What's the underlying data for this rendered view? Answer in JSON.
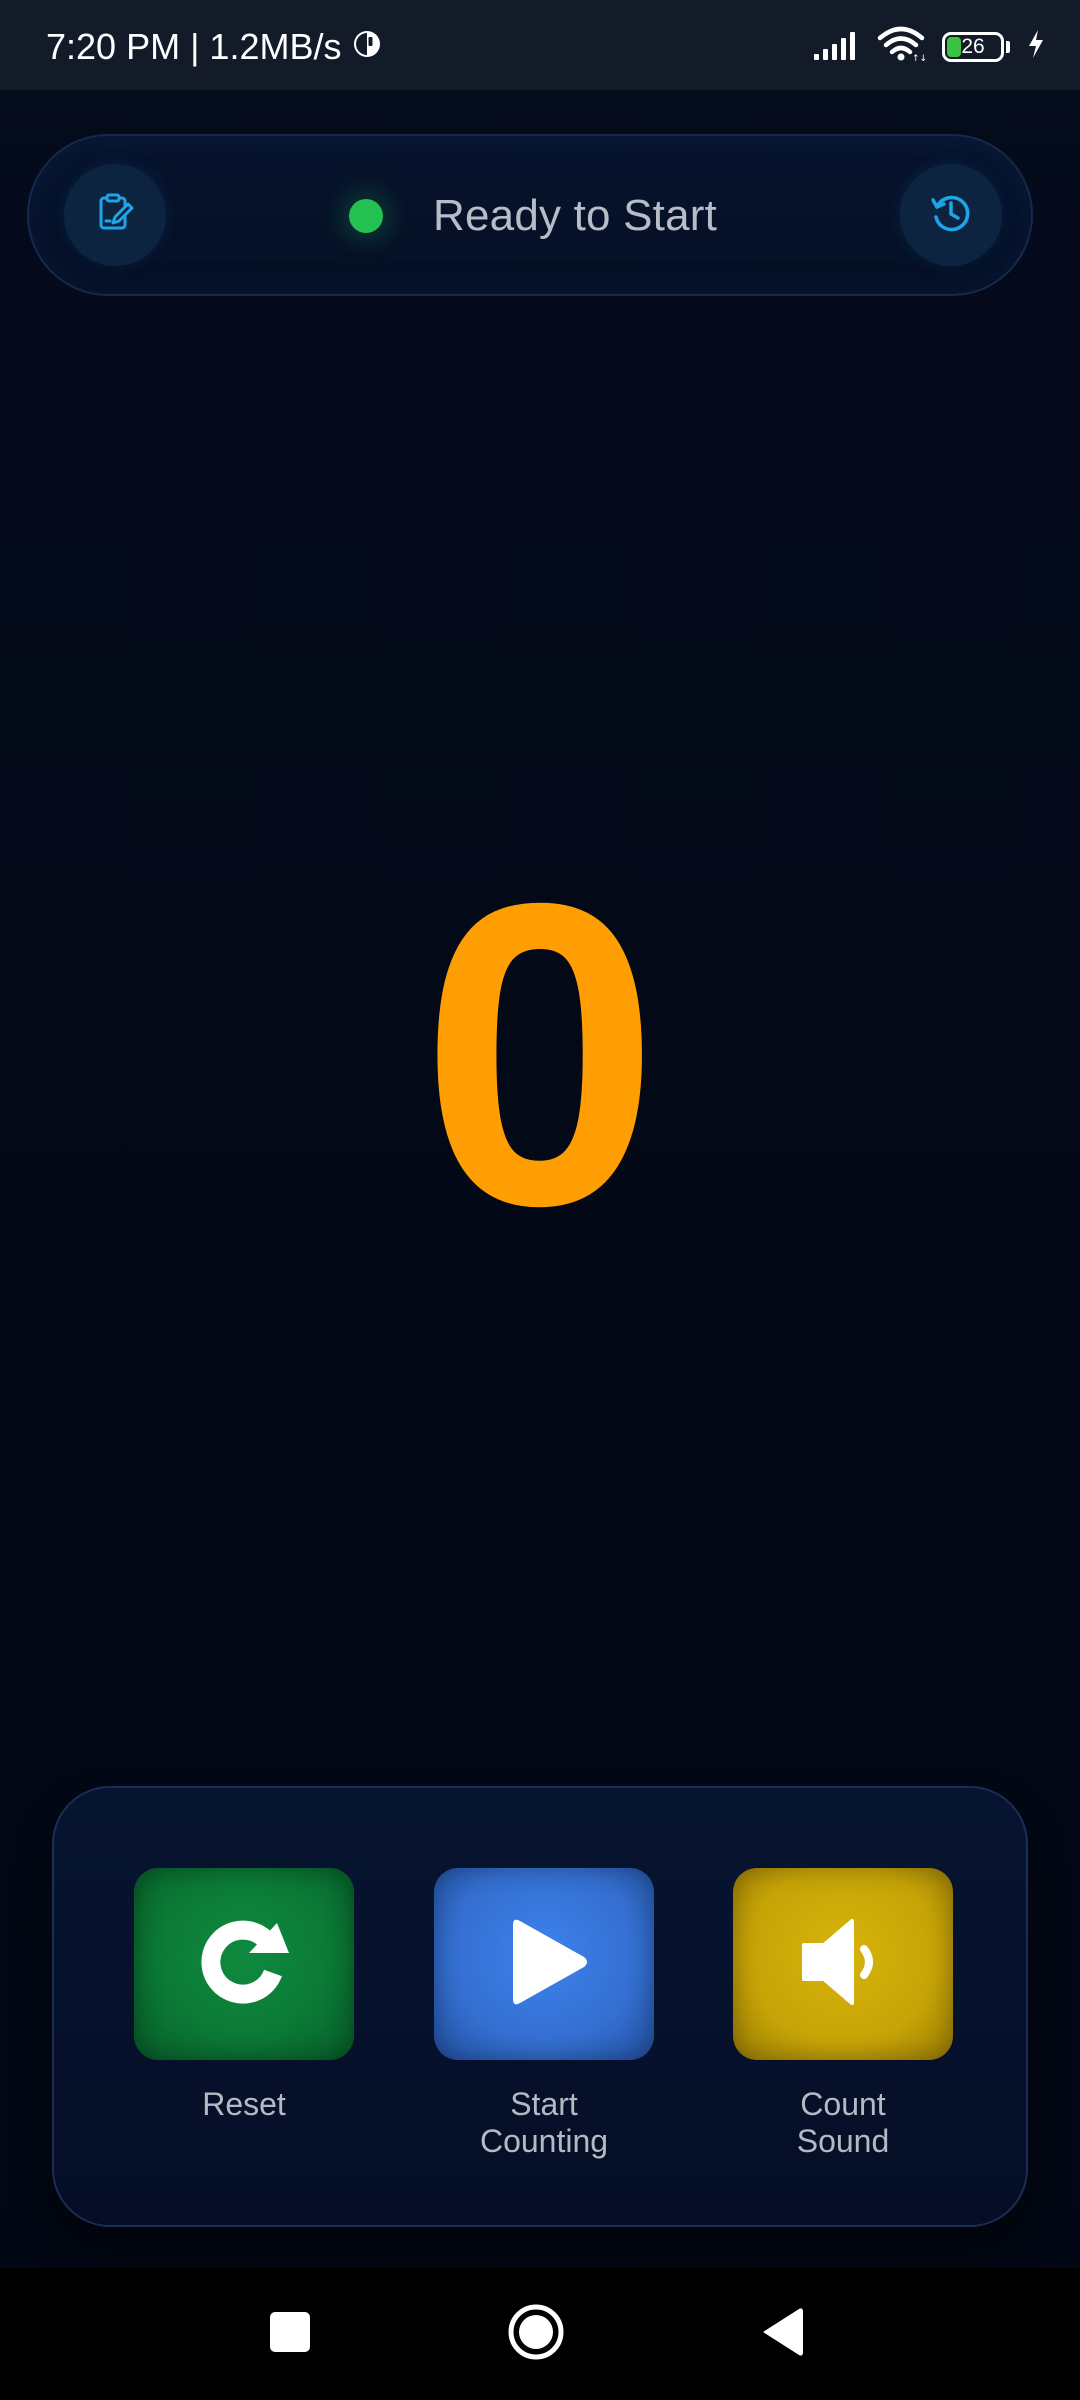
{
  "status_bar": {
    "time_speed": "7:20 PM | 1.2MB/s",
    "battery_level": "26",
    "icons": [
      "data-saver-icon",
      "signal-icon",
      "wifi-icon",
      "battery-icon",
      "charging-icon"
    ]
  },
  "header": {
    "left_button_icon": "clipboard-edit-icon",
    "status_text": "Ready to Start",
    "status_color": "#25c052",
    "right_button_icon": "history-clock-icon"
  },
  "counter": {
    "value": "0",
    "color": "#ff9e02"
  },
  "controls": {
    "reset": {
      "label": "Reset",
      "icon": "reset-icon",
      "color": "#0b7a36"
    },
    "start": {
      "label_line1": "Start",
      "label_line2": "Counting",
      "icon": "play-icon",
      "color": "#346fd0"
    },
    "sound": {
      "label_line1": "Count",
      "label_line2": "Sound",
      "icon": "speaker-icon",
      "color": "#c7a407"
    }
  },
  "nav_bar": {
    "buttons": [
      "recents-button",
      "home-button",
      "back-button"
    ]
  }
}
